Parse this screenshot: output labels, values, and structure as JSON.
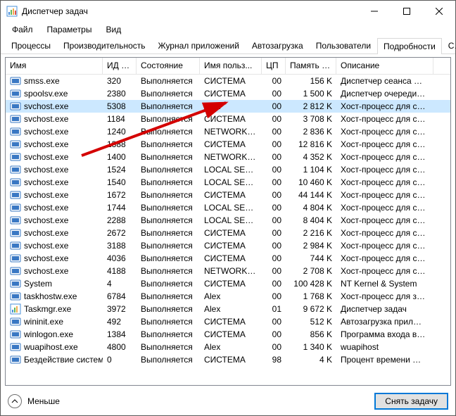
{
  "window": {
    "title": "Диспетчер задач"
  },
  "menu": {
    "file": "Файл",
    "options": "Параметры",
    "view": "Вид"
  },
  "tabs": {
    "processes": "Процессы",
    "performance": "Производительность",
    "apphistory": "Журнал приложений",
    "startup": "Автозагрузка",
    "users": "Пользователи",
    "details": "Подробности",
    "services_short": "С…"
  },
  "columns": {
    "name": "Имя",
    "pid": "ИД п...",
    "state": "Состояние",
    "user": "Имя польз...",
    "cpu": "ЦП",
    "memory": "Память (ч...",
    "description": "Описание"
  },
  "rows": [
    {
      "name": "smss.exe",
      "pid": "320",
      "state": "Выполняется",
      "user": "СИСТЕМА",
      "cpu": "00",
      "mem": "156 K",
      "desc": "Диспетчер сеанса …",
      "icon": "proc"
    },
    {
      "name": "spoolsv.exe",
      "pid": "2380",
      "state": "Выполняется",
      "user": "СИСТЕМА",
      "cpu": "00",
      "mem": "1 500 K",
      "desc": "Диспетчер очереди…",
      "icon": "proc"
    },
    {
      "name": "svchost.exe",
      "pid": "5308",
      "state": "Выполняется",
      "user": "Alex",
      "cpu": "00",
      "mem": "2 812 K",
      "desc": "Хост-процесс для с…",
      "icon": "proc",
      "selected": true
    },
    {
      "name": "svchost.exe",
      "pid": "1184",
      "state": "Выполняется",
      "user": "СИСТЕМА",
      "cpu": "00",
      "mem": "3 708 K",
      "desc": "Хост-процесс для с…",
      "icon": "proc"
    },
    {
      "name": "svchost.exe",
      "pid": "1240",
      "state": "Выполняется",
      "user": "NETWORK…",
      "cpu": "00",
      "mem": "2 836 K",
      "desc": "Хост-процесс для с…",
      "icon": "proc"
    },
    {
      "name": "svchost.exe",
      "pid": "1388",
      "state": "Выполняется",
      "user": "СИСТЕМА",
      "cpu": "00",
      "mem": "12 816 K",
      "desc": "Хост-процесс для с…",
      "icon": "proc"
    },
    {
      "name": "svchost.exe",
      "pid": "1400",
      "state": "Выполняется",
      "user": "NETWORK…",
      "cpu": "00",
      "mem": "4 352 K",
      "desc": "Хост-процесс для с…",
      "icon": "proc"
    },
    {
      "name": "svchost.exe",
      "pid": "1524",
      "state": "Выполняется",
      "user": "LOCAL SE…",
      "cpu": "00",
      "mem": "1 104 K",
      "desc": "Хост-процесс для с…",
      "icon": "proc"
    },
    {
      "name": "svchost.exe",
      "pid": "1540",
      "state": "Выполняется",
      "user": "LOCAL SE…",
      "cpu": "00",
      "mem": "10 460 K",
      "desc": "Хост-процесс для с…",
      "icon": "proc"
    },
    {
      "name": "svchost.exe",
      "pid": "1672",
      "state": "Выполняется",
      "user": "СИСТЕМА",
      "cpu": "00",
      "mem": "44 144 K",
      "desc": "Хост-процесс для с…",
      "icon": "proc"
    },
    {
      "name": "svchost.exe",
      "pid": "1744",
      "state": "Выполняется",
      "user": "LOCAL SE…",
      "cpu": "00",
      "mem": "4 804 K",
      "desc": "Хост-процесс для с…",
      "icon": "proc"
    },
    {
      "name": "svchost.exe",
      "pid": "2288",
      "state": "Выполняется",
      "user": "LOCAL SE…",
      "cpu": "00",
      "mem": "8 404 K",
      "desc": "Хост-процесс для с…",
      "icon": "proc"
    },
    {
      "name": "svchost.exe",
      "pid": "2672",
      "state": "Выполняется",
      "user": "СИСТЕМА",
      "cpu": "00",
      "mem": "2 216 K",
      "desc": "Хост-процесс для с…",
      "icon": "proc"
    },
    {
      "name": "svchost.exe",
      "pid": "3188",
      "state": "Выполняется",
      "user": "СИСТЕМА",
      "cpu": "00",
      "mem": "2 984 K",
      "desc": "Хост-процесс для с…",
      "icon": "proc"
    },
    {
      "name": "svchost.exe",
      "pid": "4036",
      "state": "Выполняется",
      "user": "СИСТЕМА",
      "cpu": "00",
      "mem": "744 K",
      "desc": "Хост-процесс для с…",
      "icon": "proc"
    },
    {
      "name": "svchost.exe",
      "pid": "4188",
      "state": "Выполняется",
      "user": "NETWORK…",
      "cpu": "00",
      "mem": "2 708 K",
      "desc": "Хост-процесс для с…",
      "icon": "proc"
    },
    {
      "name": "System",
      "pid": "4",
      "state": "Выполняется",
      "user": "СИСТЕМА",
      "cpu": "00",
      "mem": "100 428 K",
      "desc": "NT Kernel & System",
      "icon": "proc"
    },
    {
      "name": "taskhostw.exe",
      "pid": "6784",
      "state": "Выполняется",
      "user": "Alex",
      "cpu": "00",
      "mem": "1 768 K",
      "desc": "Хост-процесс для за…",
      "icon": "proc"
    },
    {
      "name": "Taskmgr.exe",
      "pid": "3972",
      "state": "Выполняется",
      "user": "Alex",
      "cpu": "01",
      "mem": "9 672 K",
      "desc": "Диспетчер задач",
      "icon": "taskmgr"
    },
    {
      "name": "wininit.exe",
      "pid": "492",
      "state": "Выполняется",
      "user": "СИСТЕМА",
      "cpu": "00",
      "mem": "512 K",
      "desc": "Автозагрузка прил…",
      "icon": "proc"
    },
    {
      "name": "winlogon.exe",
      "pid": "1384",
      "state": "Выполняется",
      "user": "СИСТЕМА",
      "cpu": "00",
      "mem": "856 K",
      "desc": "Программа входа в…",
      "icon": "proc"
    },
    {
      "name": "wuapihost.exe",
      "pid": "4800",
      "state": "Выполняется",
      "user": "Alex",
      "cpu": "00",
      "mem": "1 340 K",
      "desc": "wuapihost",
      "icon": "proc"
    },
    {
      "name": "Бездействие системы",
      "pid": "0",
      "state": "Выполняется",
      "user": "СИСТЕМА",
      "cpu": "98",
      "mem": "4 K",
      "desc": "Процент времени …",
      "icon": "proc"
    }
  ],
  "footer": {
    "fewer": "Меньше",
    "end_task": "Снять задачу"
  }
}
